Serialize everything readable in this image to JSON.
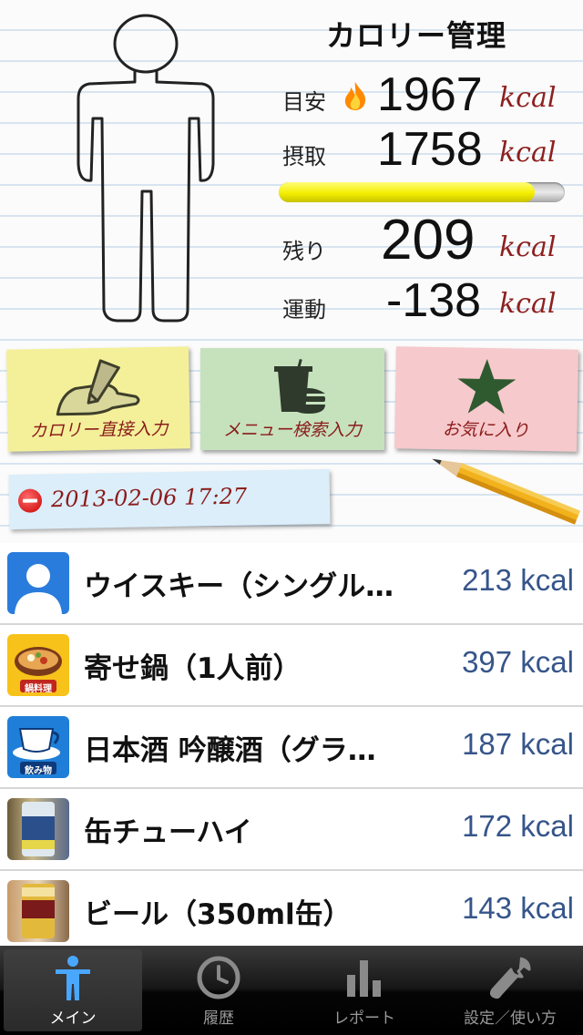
{
  "header": {
    "title": "カロリー管理"
  },
  "stats": {
    "target": {
      "label": "目安",
      "value": "1967",
      "unit": "kcal"
    },
    "intake": {
      "label": "摂取",
      "value": "1758",
      "unit": "kcal"
    },
    "intake_ratio": 0.894,
    "remaining": {
      "label": "残り",
      "value": "209",
      "unit": "kcal"
    },
    "exercise": {
      "label": "運動",
      "value": "-138",
      "unit": "kcal"
    }
  },
  "buttons": {
    "direct": "カロリー直接入力",
    "menu": "メニュー検索入力",
    "favorite": "お気に入り"
  },
  "date_label": "2013-02-06 17:27",
  "entries": [
    {
      "name": "ウイスキー（シングル…",
      "kcal": "213 kcal"
    },
    {
      "name": "寄せ鍋（1人前）",
      "kcal": "397 kcal",
      "thumb_text": "鍋料理"
    },
    {
      "name": "日本酒 吟醸酒（グラ…",
      "kcal": "187 kcal",
      "thumb_text": "飲み物"
    },
    {
      "name": "缶チューハイ",
      "kcal": "172 kcal"
    },
    {
      "name": "ビール（350ml缶）",
      "kcal": "143 kcal"
    }
  ],
  "tabs": [
    {
      "label": "メイン",
      "icon": "person-icon",
      "active": true
    },
    {
      "label": "履歴",
      "icon": "clock-icon",
      "active": false
    },
    {
      "label": "レポート",
      "icon": "bar-chart-icon",
      "active": false
    },
    {
      "label": "設定／使い方",
      "icon": "wrench-icon",
      "active": false
    }
  ],
  "colors": {
    "kcal_unit": "#8e2020",
    "kcal_value": "#36558a",
    "progress": "#f4ef00"
  }
}
